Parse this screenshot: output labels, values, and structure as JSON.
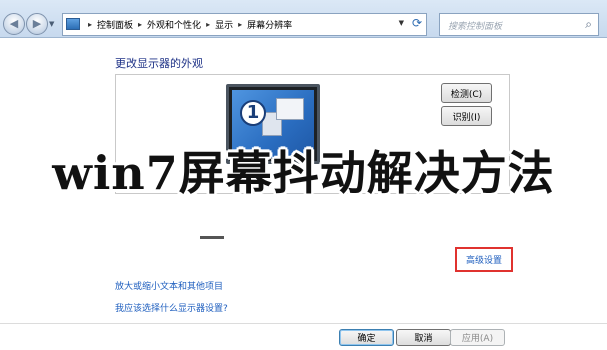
{
  "address": {
    "crumbs": [
      "控制面板",
      "外观和个性化",
      "显示",
      "屏幕分辨率"
    ],
    "search_placeholder": "搜索控制面板"
  },
  "content": {
    "heading": "更改显示器的外观",
    "monitor_number": "1",
    "detect_button": "检测(C)",
    "identify_button": "识别(I)",
    "advanced_link": "高级设置",
    "links": [
      "放大或缩小文本和其他项目",
      "我应该选择什么显示器设置?"
    ]
  },
  "overlay": {
    "title": "win7屏幕抖动解决方法"
  },
  "buttons": {
    "ok": "确定",
    "cancel": "取消",
    "apply": "应用(A)"
  },
  "colors": {
    "link": "#1f5fbf",
    "highlight_border": "#e0322f",
    "heading": "#1e3287"
  }
}
